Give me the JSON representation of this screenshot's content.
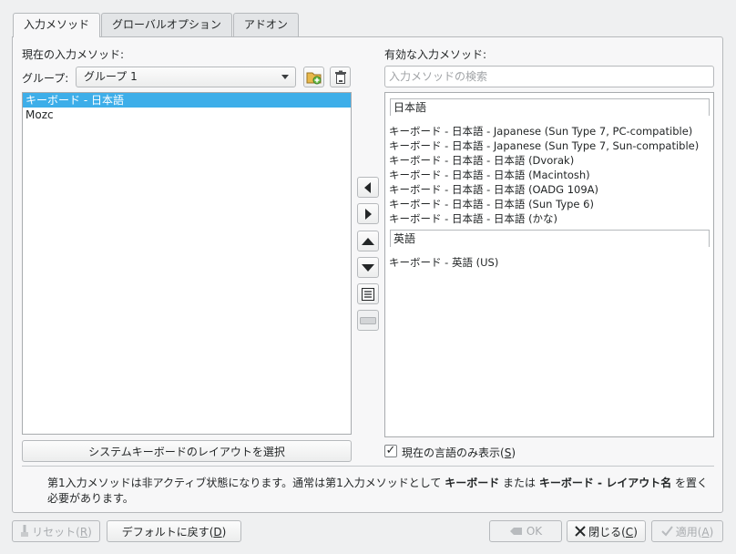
{
  "tabs": [
    {
      "label": "入力メソッド",
      "active": true
    },
    {
      "label": "グローバルオプション",
      "active": false
    },
    {
      "label": "アドオン",
      "active": false
    }
  ],
  "left": {
    "current_label": "現在の入力メソッド:",
    "group_label": "グループ:",
    "group_value": "グループ 1",
    "items": [
      "キーボード - 日本語",
      "Mozc"
    ],
    "layout_button": "システムキーボードのレイアウトを選択"
  },
  "right": {
    "available_label": "有効な入力メソッド:",
    "search_placeholder": "入力メソッドの検索",
    "groups": [
      {
        "name": "日本語",
        "entries": [
          "キーボード - 日本語 - Japanese (Sun Type 7, PC-compatible)",
          "キーボード - 日本語 - Japanese (Sun Type 7, Sun-compatible)",
          "キーボード - 日本語 - 日本語 (Dvorak)",
          "キーボード - 日本語 - 日本語 (Macintosh)",
          "キーボード - 日本語 - 日本語 (OADG 109A)",
          "キーボード - 日本語 - 日本語 (Sun Type 6)",
          "キーボード - 日本語 - 日本語 (かな)"
        ]
      },
      {
        "name": "英語",
        "entries": [
          "キーボード - 英語 (US)"
        ]
      }
    ],
    "only_current_language": "現在の言語のみ表示(",
    "only_current_language_key": "S",
    "only_current_language_end": ")",
    "only_current_checked": true
  },
  "note": {
    "part1": "第1入力メソッドは非アクティブ状態になります。通常は第1入力メソッドとして ",
    "bold1": "キーボード",
    "part2": " または ",
    "bold2": "キーボード - レイアウト名",
    "part3": " を置く必要があります。"
  },
  "footer": {
    "reset": "リセット(",
    "reset_key": "R",
    "reset_end": ")",
    "defaults": "デフォルトに戻す(",
    "defaults_key": "D",
    "defaults_end": ")",
    "ok": "OK",
    "close": "閉じる(",
    "close_key": "C",
    "close_end": ")",
    "apply": "適用(",
    "apply_key": "A",
    "apply_end": ")"
  },
  "colors": {
    "selection": "#3daee9",
    "window_bg": "#eff0f1"
  }
}
